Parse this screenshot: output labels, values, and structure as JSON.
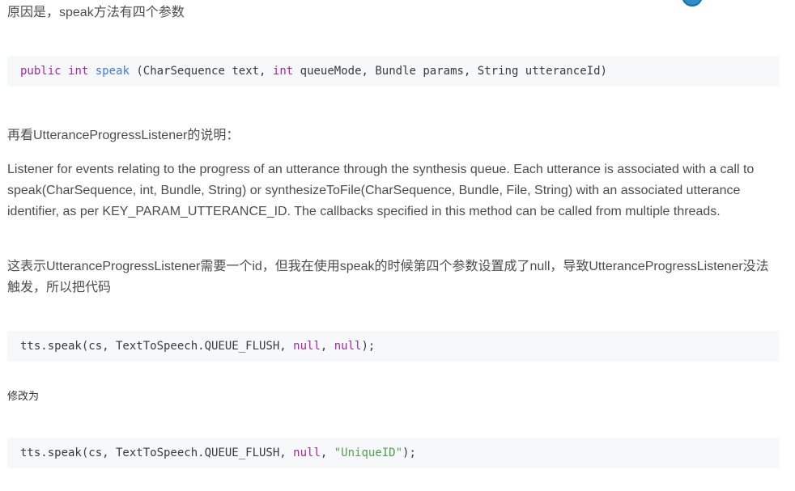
{
  "intro": {
    "text": "原因是，speak方法有四个参数"
  },
  "code1": {
    "kw1": "public",
    "kw2": "int",
    "fn": "speak",
    "p1": " (CharSequence text, ",
    "kw3": "int",
    "p2": " queueMode, Bundle params, String utteranceId)"
  },
  "listener_intro": {
    "text": "再看UtteranceProgressListener的说明："
  },
  "doc_quote": {
    "text": "Listener for events relating to the progress of an utterance through the synthesis queue. Each utterance is associated with a call to speak(CharSequence, int, Bundle, String) or synthesizeToFile(CharSequence, Bundle, File, String) with an associated utterance identifier, as per KEY_PARAM_UTTERANCE_ID. The callbacks specified in this method can be called from multiple threads."
  },
  "explain": {
    "text": "这表示UtteranceProgressListener需要一个id，但我在使用speak的时候第四个参数设置成了null，导致UtteranceProgressListener没法触发，所以把代码"
  },
  "code2": {
    "p1": "tts.speak(cs, TextToSpeech.QUEUE_FLUSH, ",
    "lit1": "null",
    "sep": ", ",
    "lit2": "null",
    "end": ");"
  },
  "modify": {
    "text": "修改为"
  },
  "code3": {
    "p1": "tts.speak(cs, TextToSpeech.QUEUE_FLUSH, ",
    "lit1": "null",
    "sep": ", ",
    "str": "\"UniqueID\"",
    "end": ");"
  }
}
